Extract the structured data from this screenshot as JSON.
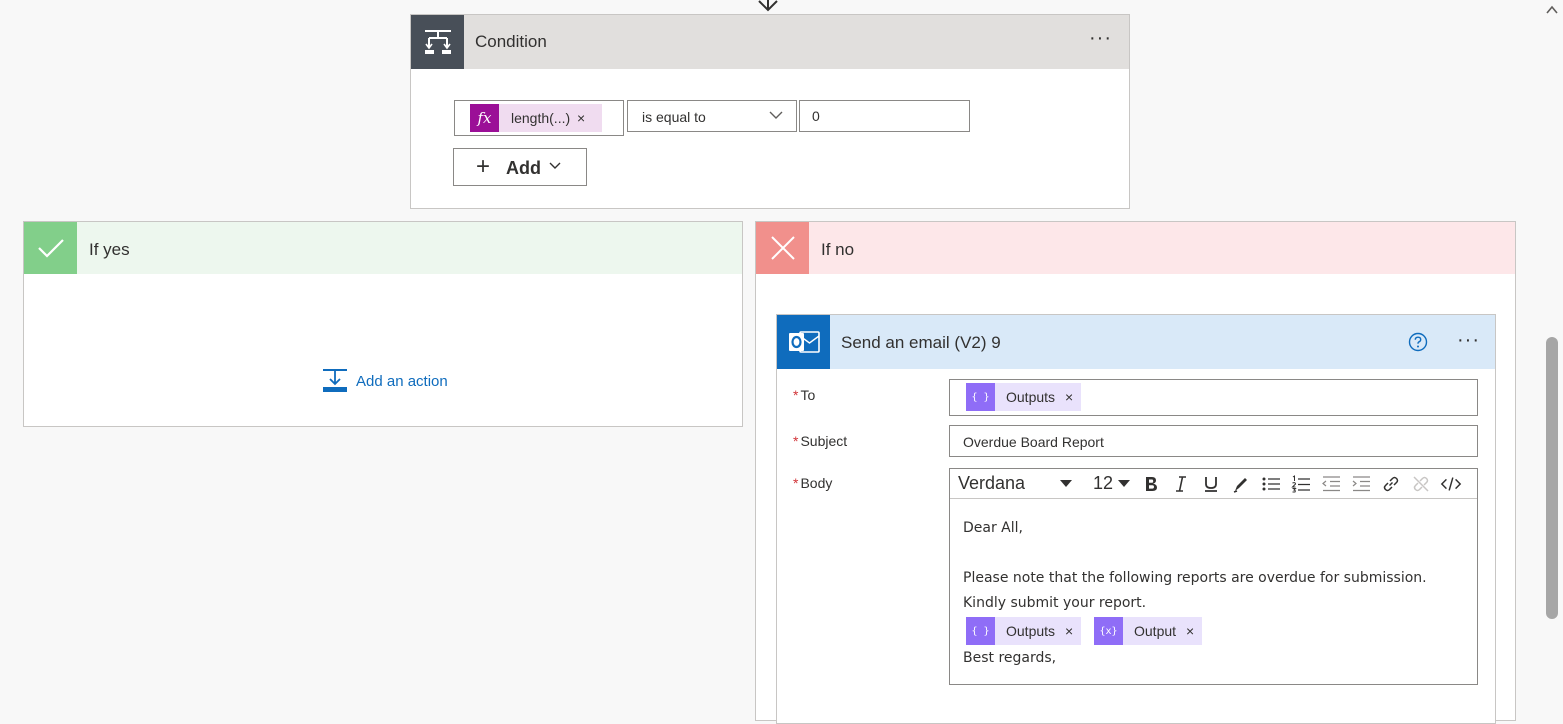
{
  "condition": {
    "title": "Condition",
    "menu_label": "···",
    "left_token": "length(...)",
    "token_remove": "×",
    "operator": "is equal to",
    "value": "0",
    "add_label": "Add"
  },
  "if_yes": {
    "title": "If yes",
    "add_action_label": "Add an action"
  },
  "if_no": {
    "title": "If no"
  },
  "email": {
    "title": "Send an email (V2) 9",
    "menu_label": "···",
    "to_label": "To",
    "subject_label": "Subject",
    "body_label": "Body",
    "required_mark": "*",
    "to_token": "Outputs",
    "subject_value": "Overdue Board Report",
    "toolbar": {
      "font": "Verdana",
      "size": "12"
    },
    "body": {
      "line1": "Dear All,",
      "line2": "Please note that the following reports are overdue for submission.",
      "line3": "Kindly submit your report.",
      "token1": "Outputs",
      "token2": "Output",
      "line4": "Best regards,"
    }
  },
  "colors": {
    "condition_icon_bg": "#484f58",
    "yes_accent": "#82cf8a",
    "no_accent": "#f1908c",
    "email_accent": "#0f6cbd",
    "expression_token": "#9b0f97",
    "dynamic_token": "#8f6df7"
  }
}
